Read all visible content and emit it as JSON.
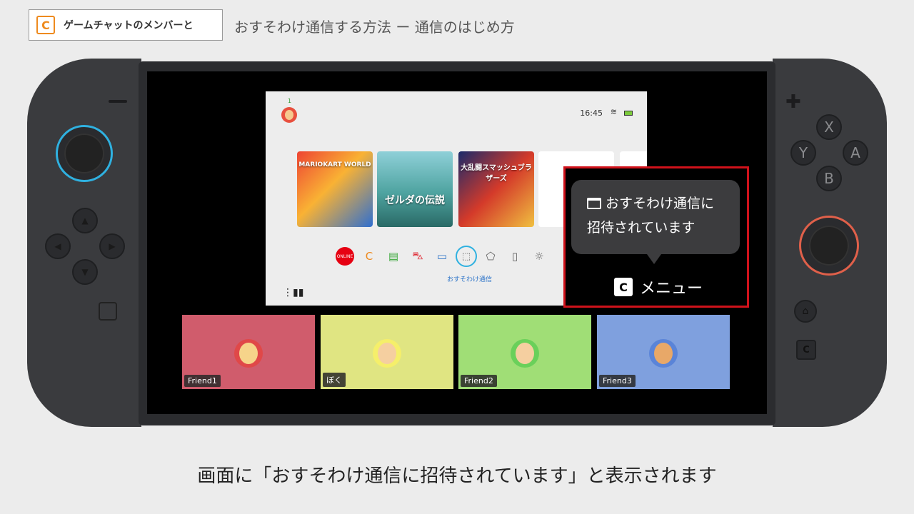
{
  "header": {
    "badge_icon": "C",
    "badge_text": "ゲームチャットのメンバーと",
    "title": "おすそわけ通信する方法 ー 通信のはじめ方"
  },
  "console": {
    "left_joycon": {
      "minus": "−",
      "dpad": [
        "▲",
        "◀",
        "▶",
        "▼"
      ]
    },
    "right_joycon": {
      "plus": "✚",
      "buttons": [
        "X",
        "Y",
        "A",
        "B"
      ],
      "home": "⌂",
      "c_button": "C"
    }
  },
  "home_screen": {
    "user_count": "1",
    "time": "16:45",
    "wifi_icon": "wifi-icon",
    "games": [
      {
        "title": "MARIOKART WORLD"
      },
      {
        "title": "ゼルダの伝説"
      },
      {
        "title": "大乱闘スマッシュブラザーズ"
      }
    ],
    "dock": {
      "online_label": "ONLINE",
      "icons": [
        "C",
        "▤",
        "⛍",
        "▭",
        "⬚",
        "⬠",
        "▯",
        "☼"
      ],
      "selected_caption": "おすそわけ通信"
    }
  },
  "popup": {
    "message_line1": "おすそわけ通信に",
    "message_line2": "招待されています",
    "menu_key": "C",
    "menu_label": "メニュー"
  },
  "friends": [
    {
      "name": "Friend1",
      "color": "#d05c6c"
    },
    {
      "name": "ぼく",
      "color": "#e0e582"
    },
    {
      "name": "Friend2",
      "color": "#a0de76"
    },
    {
      "name": "Friend3",
      "color": "#7fa0de"
    }
  ],
  "caption": "画面に「おすそわけ通信に招待されています」と表示されます"
}
